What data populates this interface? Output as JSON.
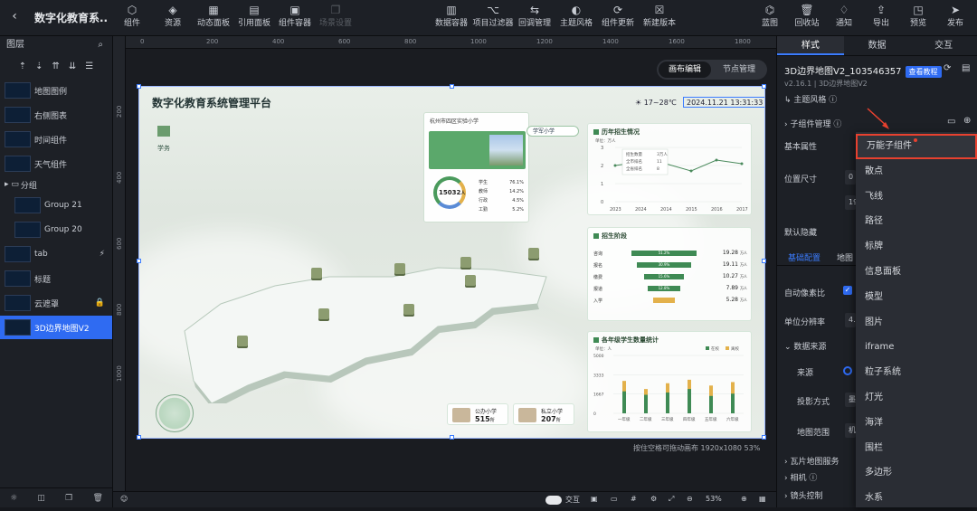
{
  "topbar": {
    "back_icon": "back-arrow-icon",
    "title": "数字化教育系...",
    "left_tools": [
      {
        "label": "组件",
        "icon": "component-icon"
      },
      {
        "label": "资源",
        "icon": "resource-icon"
      },
      {
        "label": "动态面板",
        "icon": "dynamic-panel-icon"
      },
      {
        "label": "引用面板",
        "icon": "reference-panel-icon"
      },
      {
        "label": "组件容器",
        "icon": "container-icon"
      },
      {
        "label": "场景设置",
        "icon": "scene-icon"
      }
    ],
    "mid_tools": [
      {
        "label": "数据容器",
        "icon": "data-container-icon"
      },
      {
        "label": "项目过滤器",
        "icon": "filter-icon"
      },
      {
        "label": "回调管理",
        "icon": "callback-icon"
      },
      {
        "label": "主题风格",
        "icon": "theme-icon"
      },
      {
        "label": "组件更新",
        "icon": "update-icon"
      },
      {
        "label": "新建版本",
        "icon": "new-version-icon"
      }
    ],
    "right_tools": [
      {
        "label": "蓝图",
        "icon": "blueprint-icon"
      },
      {
        "label": "回收站",
        "icon": "trash-icon"
      },
      {
        "label": "通知",
        "icon": "bell-icon"
      },
      {
        "label": "导出",
        "icon": "export-icon"
      },
      {
        "label": "预览",
        "icon": "preview-icon"
      },
      {
        "label": "发布",
        "icon": "publish-icon"
      }
    ]
  },
  "layers": {
    "title": "图层",
    "items": [
      {
        "label": "地图图例",
        "indent": false,
        "lock": ""
      },
      {
        "label": "右侧图表",
        "indent": false,
        "lock": ""
      },
      {
        "label": "时间组件",
        "indent": false,
        "lock": ""
      },
      {
        "label": "天气组件",
        "indent": false,
        "lock": ""
      },
      {
        "label": "分组",
        "indent": false,
        "lock": "",
        "folder": true
      },
      {
        "label": "Group 21",
        "indent": true,
        "lock": ""
      },
      {
        "label": "Group 20",
        "indent": true,
        "lock": ""
      },
      {
        "label": "tab",
        "indent": false,
        "lock": "⚡"
      },
      {
        "label": "标题",
        "indent": false,
        "lock": ""
      },
      {
        "label": "云遮罩",
        "indent": false,
        "lock": "🔒"
      },
      {
        "label": "3D边界地图V2",
        "indent": false,
        "lock": "",
        "selected": true
      }
    ]
  },
  "canvas": {
    "ruler_h": [
      "0",
      "200",
      "400",
      "600",
      "800",
      "1000",
      "1200",
      "1400",
      "1600",
      "1800"
    ],
    "ruler_v": [
      "200",
      "400",
      "600",
      "800",
      "1000"
    ],
    "toggle": {
      "edit": "画布编辑",
      "node": "节点管理"
    },
    "artboard": {
      "title": "数字化教育系统管理平台",
      "weather": "17~28℃",
      "datetime": "2024.11.21 13:31:33",
      "legend_label": "学务",
      "popup": {
        "school": "杭州市四区实验小学",
        "total": "15032",
        "unit": "人",
        "stats": [
          {
            "k": "学生",
            "v": "76.1%"
          },
          {
            "k": "教师",
            "v": "14.2%"
          },
          {
            "k": "行政",
            "v": "4.5%"
          },
          {
            "k": "工勤",
            "v": "5.2%"
          }
        ]
      },
      "tag": "学军小学",
      "panel_history": {
        "title": "历年招生情况",
        "unit": "单位：万人",
        "years": [
          "2023",
          "2024",
          "2014",
          "2015",
          "2016",
          "2017"
        ],
        "y_ticks": [
          "3",
          "2",
          "1",
          "0"
        ],
        "tooltip": [
          {
            "k": "招生数量",
            "v": "3万人"
          },
          {
            "k": "全市排名",
            "v": "11"
          },
          {
            "k": "全省排名",
            "v": "8"
          }
        ],
        "values": [
          2.0,
          2.2,
          2.1,
          1.7,
          2.3,
          2.1
        ]
      },
      "panel_stage": {
        "title": "招生阶段",
        "rows": [
          {
            "label": "咨询",
            "pct": "51.2%",
            "value": "19.28",
            "unit": "万人",
            "ratio": 0.9
          },
          {
            "label": "报名",
            "pct": "30.9%",
            "value": "19.11",
            "unit": "万人",
            "ratio": 0.75
          },
          {
            "label": "缴费",
            "pct": "15.6%",
            "value": "10.27",
            "unit": "万人",
            "ratio": 0.55
          },
          {
            "label": "报道",
            "pct": "12.8%",
            "value": "7.89",
            "unit": "万人",
            "ratio": 0.45
          },
          {
            "label": "入学",
            "pct": "",
            "value": "5.28",
            "unit": "万人",
            "ratio": 0.3
          }
        ]
      },
      "panel_grade": {
        "title": "各年级学生数量统计",
        "unit": "单位：人",
        "legend": [
          "在校",
          "离校"
        ],
        "y_ticks": [
          "5000",
          "3333",
          "1667",
          "0"
        ],
        "grades": [
          "一年级",
          "二年级",
          "三年级",
          "四年级",
          "五年级",
          "六年级"
        ],
        "series": [
          {
            "name": "在校",
            "values": [
              1900,
              1600,
              1800,
              2100,
              1500,
              1700
            ]
          },
          {
            "name": "离校",
            "values": [
              2800,
              2100,
              2600,
              2900,
              2400,
              2700
            ]
          }
        ]
      },
      "bottom_stats": [
        {
          "label": "公办小学",
          "value": "515",
          "unit": "所"
        },
        {
          "label": "私立小学",
          "value": "207",
          "unit": "所"
        }
      ]
    },
    "status": "按住空格可拖动画布   1920x1080 53%",
    "bottom": {
      "toggle_label": "交互",
      "zoom": "53%"
    }
  },
  "right": {
    "tabs": [
      "样式",
      "数据",
      "交互"
    ],
    "component_name": "3D边界地图V2_103546357",
    "doc_button": "查看教程",
    "version": "v2.16.1 | 3D边界地图V2",
    "theme_label": "主题风格",
    "sub_manage": "子组件管理",
    "basic_attr": "基本属性",
    "pos_size": "位置尺寸",
    "pos_vals": [
      "0",
      "19"
    ],
    "default_hidden": "默认隐藏",
    "sub_tabs": [
      "基础配置",
      "地图"
    ],
    "auto_pixel": "自动像素比",
    "unit_res": "单位分辨率",
    "unit_res_val": "4.5",
    "data_source": "数据来源",
    "source": "来源",
    "projection": "投影方式",
    "proj_val": "墨",
    "map_range": "地图范围",
    "map_range_val": "机",
    "tile_service": "瓦片地图服务",
    "camera": "相机",
    "lens": "镜头控制"
  },
  "menu": {
    "items": [
      "万能子组件",
      "散点",
      "飞线",
      "路径",
      "标牌",
      "信息面板",
      "模型",
      "图片",
      "iframe",
      "粒子系统",
      "灯光",
      "海洋",
      "围栏",
      "多边形",
      "水系"
    ],
    "highlight_index": 0
  },
  "colors": {
    "accent": "#2f6bf2",
    "highlight": "#e8412f",
    "green": "#3f8a54",
    "amber": "#e3b14b"
  }
}
